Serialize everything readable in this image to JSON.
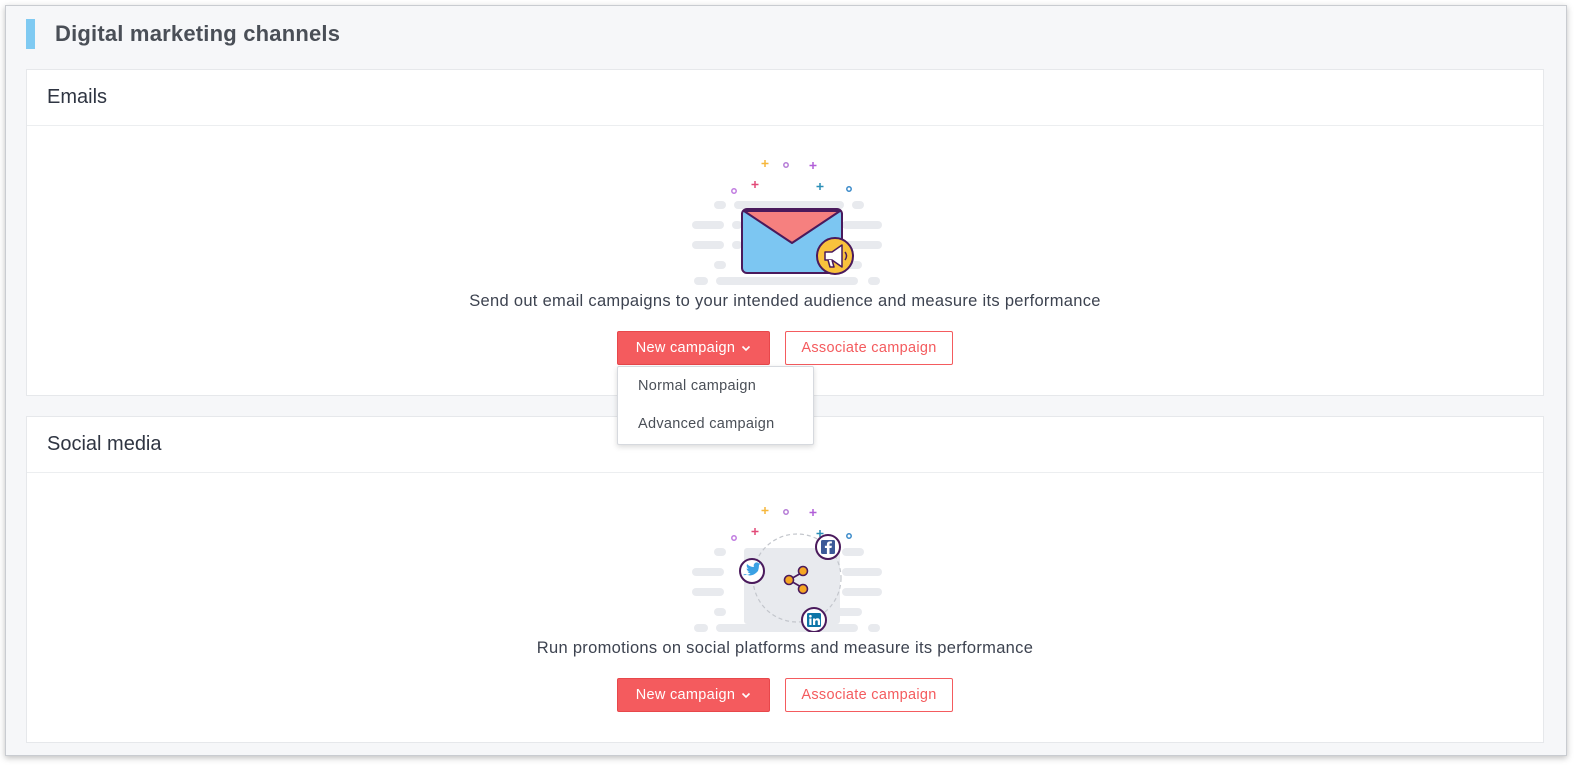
{
  "page": {
    "title": "Digital marketing channels"
  },
  "emails": {
    "title": "Emails",
    "description": "Send out email campaigns to your intended audience and measure its performance",
    "new_campaign_label": "New campaign",
    "associate_label": "Associate campaign",
    "dropdown": {
      "items": [
        "Normal campaign",
        "Advanced campaign"
      ]
    }
  },
  "social": {
    "title": "Social media",
    "description": "Run promotions on social platforms and measure its performance",
    "new_campaign_label": "New campaign",
    "associate_label": "Associate campaign"
  },
  "icons": {
    "email_illustration": "email-megaphone-illustration",
    "social_illustration": "social-share-illustration",
    "dropdown_chevron": "chevron-down-icon"
  },
  "colors": {
    "accent": "#7fcaf2",
    "primary": "#f45b5e",
    "card_bg": "#ffffff",
    "page_bg": "#f6f7f9"
  }
}
